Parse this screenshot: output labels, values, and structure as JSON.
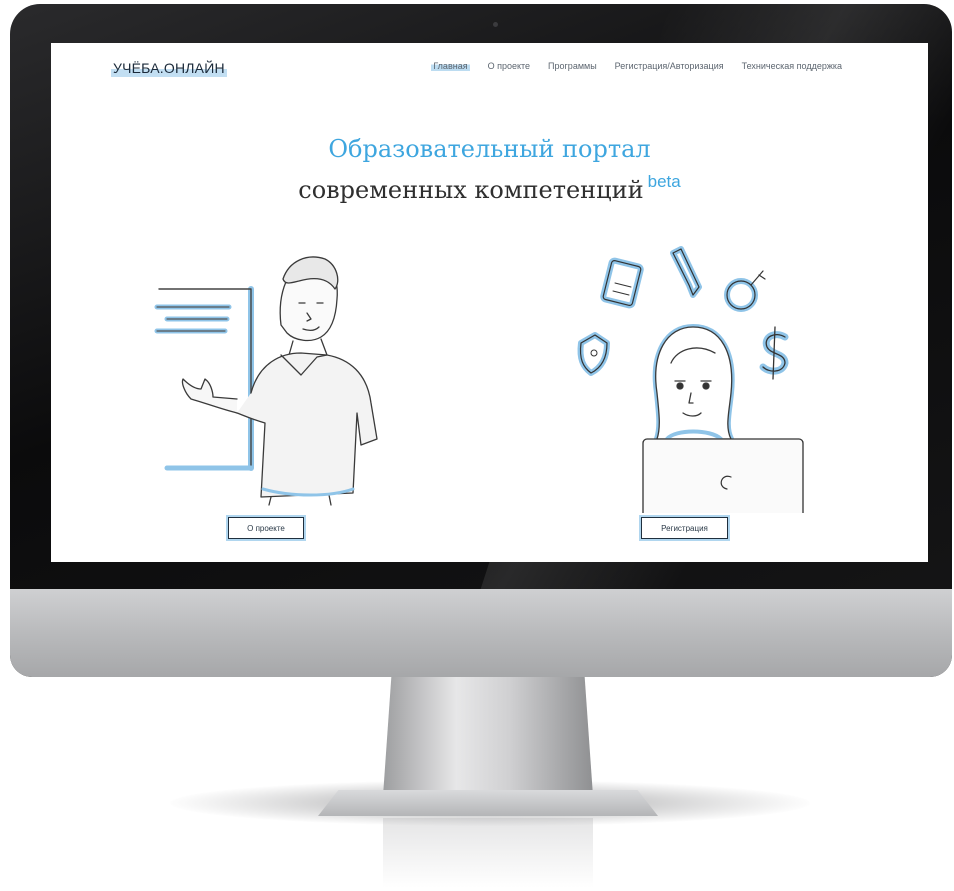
{
  "site": {
    "logo": "УЧЁБА.ОНЛАЙН"
  },
  "nav": {
    "items": [
      {
        "label": "Главная",
        "active": true
      },
      {
        "label": "О проекте",
        "active": false
      },
      {
        "label": "Программы",
        "active": false
      },
      {
        "label": "Регистрация/Авторизация",
        "active": false
      },
      {
        "label": "Техническая поддержка",
        "active": false
      }
    ]
  },
  "hero": {
    "line1": "Образовательный портал",
    "line2": "современных компетенций",
    "badge": "beta"
  },
  "buttons": {
    "about": "О проекте",
    "register": "Регистрация"
  },
  "colors": {
    "accent": "#3ea6df",
    "highlight": "#8fc4e8",
    "text": "#2f2f2f",
    "nav_text": "#5d6670"
  },
  "icons": [
    "presentation-board-icon",
    "document-icon",
    "pencil-icon",
    "key-bulb-icon",
    "shield-icon",
    "dollar-icon",
    "laptop-icon"
  ]
}
